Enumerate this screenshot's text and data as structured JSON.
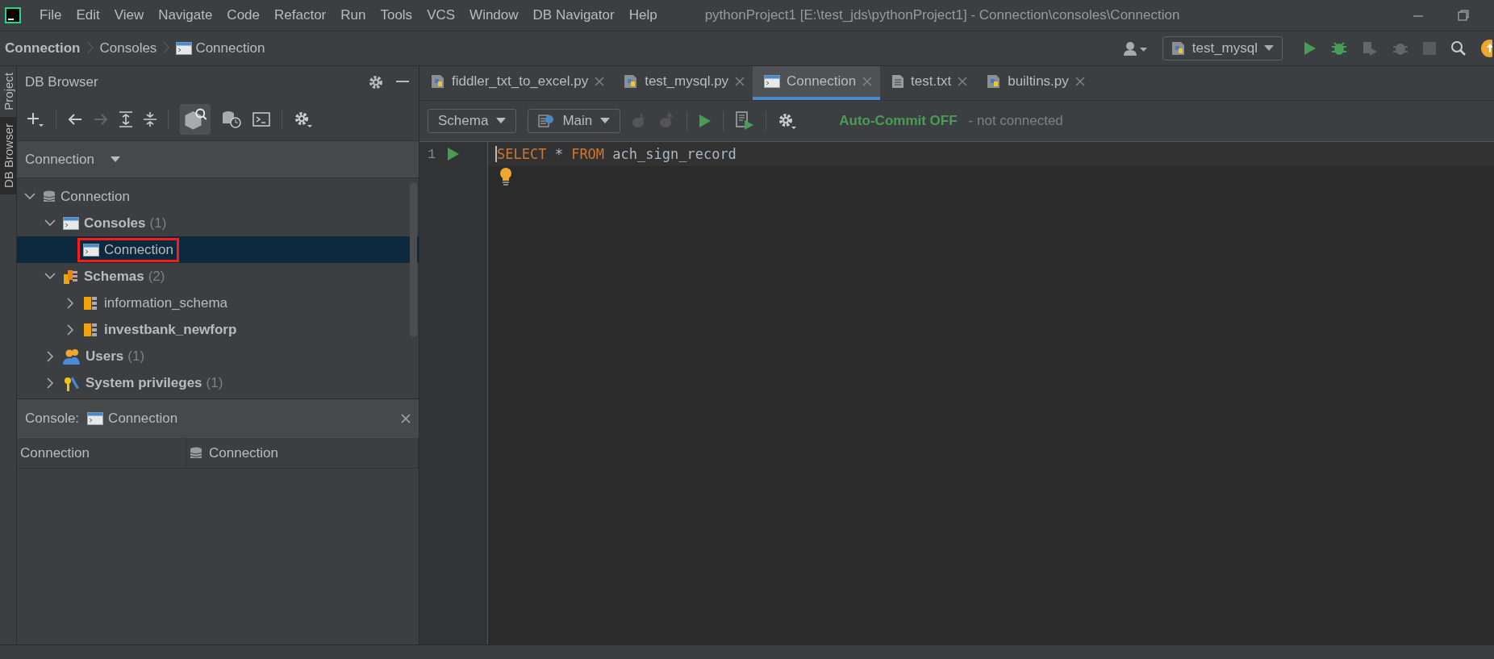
{
  "menu_bar": {
    "items": [
      "File",
      "Edit",
      "View",
      "Navigate",
      "Code",
      "Refactor",
      "Run",
      "Tools",
      "VCS",
      "Window",
      "DB Navigator",
      "Help"
    ],
    "window_title": "pythonProject1 [E:\\test_jds\\pythonProject1] - Connection\\consoles\\Connection"
  },
  "navigation_bar": {
    "breadcrumbs": [
      {
        "label": "Connection",
        "bold": true,
        "kind": "plain"
      },
      {
        "label": "Consoles",
        "bold": false,
        "kind": "plain"
      },
      {
        "label": "Connection",
        "bold": false,
        "kind": "console"
      }
    ],
    "run_configuration": "test_mysql"
  },
  "side_stripe": {
    "tabs": [
      {
        "label": "Project",
        "selected": false
      },
      {
        "label": "DB Browser",
        "selected": true
      }
    ]
  },
  "db_browser": {
    "title": "DB Browser",
    "connection_selector": "Connection",
    "tree": [
      {
        "label": "Connection",
        "kind": "database",
        "bold": false,
        "expanded": true,
        "selected": false,
        "highlighted": false,
        "children": [
          {
            "label": "Consoles",
            "count": "(1)",
            "kind": "console",
            "bold": true,
            "expanded": true,
            "selected": false,
            "highlighted": false,
            "children": [
              {
                "label": "Connection",
                "kind": "console",
                "bold": false,
                "selected": true,
                "highlighted": true
              }
            ]
          },
          {
            "label": "Schemas",
            "count": "(2)",
            "kind": "schemas",
            "bold": true,
            "expanded": true,
            "selected": false,
            "highlighted": false,
            "children": [
              {
                "label": "information_schema",
                "kind": "schema",
                "bold": false,
                "expanded": false,
                "selected": false,
                "highlighted": false
              },
              {
                "label": "investbank_newforp",
                "kind": "schema",
                "bold": true,
                "expanded": false,
                "selected": false,
                "highlighted": false
              }
            ]
          },
          {
            "label": "Users",
            "count": "(1)",
            "kind": "users",
            "bold": true,
            "expanded": false,
            "selected": false,
            "highlighted": false
          },
          {
            "label": "System privileges",
            "count": "(1)",
            "kind": "privileges",
            "bold": true,
            "expanded": false,
            "selected": false,
            "highlighted": false
          }
        ]
      }
    ],
    "console_panel": {
      "label": "Console:",
      "connection": "Connection",
      "columns": [
        {
          "label": "Connection",
          "kind": "plain"
        },
        {
          "label": "Connection",
          "kind": "database"
        }
      ]
    }
  },
  "editor": {
    "tabs": [
      {
        "label": "fiddler_txt_to_excel.py",
        "kind": "python",
        "selected": false
      },
      {
        "label": "test_mysql.py",
        "kind": "python",
        "selected": false
      },
      {
        "label": "Connection",
        "kind": "console",
        "selected": true
      },
      {
        "label": "test.txt",
        "kind": "text",
        "selected": false
      },
      {
        "label": "builtins.py",
        "kind": "python",
        "selected": false
      }
    ],
    "toolbar": {
      "schema": "Schema",
      "session": "Main",
      "auto_commit": "Auto-Commit OFF",
      "status": "- not connected"
    },
    "lines": [
      {
        "number": "1",
        "tokens": [
          {
            "kind": "keyword",
            "text": "SELECT"
          },
          {
            "kind": "plain",
            "text": " * "
          },
          {
            "kind": "keyword",
            "text": "FROM"
          },
          {
            "kind": "plain",
            "text": " ach_sign_record"
          }
        ]
      }
    ]
  }
}
